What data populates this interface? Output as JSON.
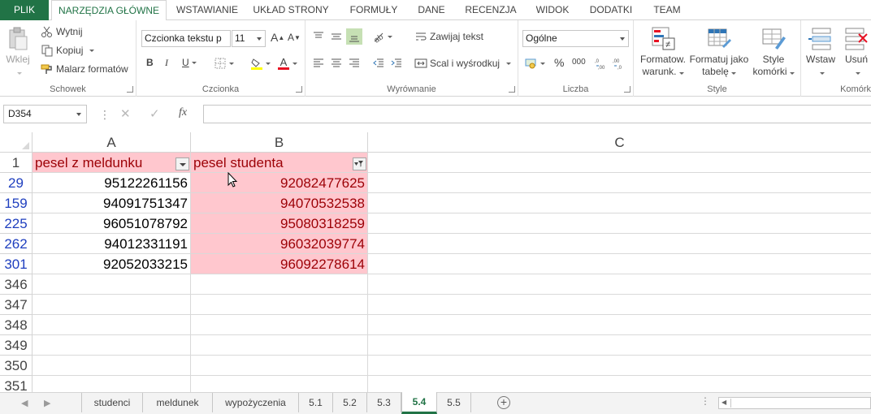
{
  "ribbon_tabs": [
    "PLIK",
    "NARZĘDZIA GŁÓWNE",
    "WSTAWIANIE",
    "UKŁAD STRONY",
    "FORMUŁY",
    "DANE",
    "RECENZJA",
    "WIDOK",
    "DODATKI",
    "TEAM"
  ],
  "clipboard": {
    "paste": "Wklej",
    "cut": "Wytnij",
    "copy": "Kopiuj",
    "format_painter": "Malarz formatów",
    "label": "Schowek"
  },
  "font": {
    "name": "Czcionka tekstu p",
    "size": "11",
    "bold": "B",
    "italic": "I",
    "underline": "U",
    "font_color_letter": "A",
    "grow": "A",
    "shrink": "A",
    "label": "Czcionka"
  },
  "alignment": {
    "wrap": "Zawijaj tekst",
    "merge": "Scal i wyśrodkuj",
    "label": "Wyrównanie"
  },
  "number": {
    "format": "Ogólne",
    "percent": "%",
    "thousands": "000",
    "label": "Liczba"
  },
  "styles": {
    "cond_format_line1": "Formatow.",
    "cond_format_line2": "warunk.",
    "format_table_line1": "Formatuj jako",
    "format_table_line2": "tabelę",
    "cell_styles_line1": "Style",
    "cell_styles_line2": "komórki",
    "label": "Style"
  },
  "cells": {
    "insert": "Wstaw",
    "delete": "Usuń",
    "label": "Komórk"
  },
  "formula_bar": {
    "name_box": "D354",
    "fx": "fx",
    "content": ""
  },
  "columns": [
    "A",
    "B",
    "C"
  ],
  "header_row": {
    "row_number": "1",
    "a": "pesel z meldunku",
    "b": "pesel studenta"
  },
  "data_rows": [
    {
      "row": "29",
      "a": "95122261156",
      "b": "92082477625"
    },
    {
      "row": "159",
      "a": "94091751347",
      "b": "94070532538"
    },
    {
      "row": "225",
      "a": "96051078792",
      "b": "95080318259"
    },
    {
      "row": "262",
      "a": "94012331191",
      "b": "96032039774"
    },
    {
      "row": "301",
      "a": "92052033215",
      "b": "96092278614"
    }
  ],
  "empty_rows": [
    "346",
    "347",
    "348",
    "349",
    "350",
    "351"
  ],
  "sheets": [
    "studenci",
    "meldunek",
    "wypożyczenia",
    "5.1",
    "5.2",
    "5.3",
    "5.4",
    "5.5"
  ],
  "active_sheet": "5.4",
  "colors": {
    "accent": "#217346",
    "highlight_fill": "#ffc7ce",
    "highlight_text": "#9c0006",
    "filtered_row_number": "#1f3fbf"
  }
}
